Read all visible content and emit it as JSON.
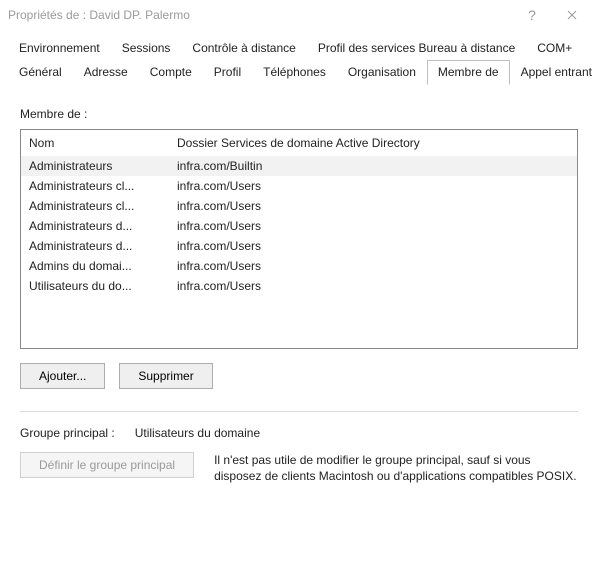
{
  "title": "Propriétés de : David DP. Palermo",
  "tabs_row1": [
    {
      "id": "environnement",
      "label": "Environnement"
    },
    {
      "id": "sessions",
      "label": "Sessions"
    },
    {
      "id": "controle",
      "label": "Contrôle à distance"
    },
    {
      "id": "profil-bureau",
      "label": "Profil des services Bureau à distance"
    },
    {
      "id": "complus",
      "label": "COM+"
    }
  ],
  "tabs_row2": [
    {
      "id": "general",
      "label": "Général"
    },
    {
      "id": "adresse",
      "label": "Adresse"
    },
    {
      "id": "compte",
      "label": "Compte"
    },
    {
      "id": "profil",
      "label": "Profil"
    },
    {
      "id": "telephones",
      "label": "Téléphones"
    },
    {
      "id": "organisation",
      "label": "Organisation"
    },
    {
      "id": "membre-de",
      "label": "Membre de"
    },
    {
      "id": "appel-entrant",
      "label": "Appel entrant"
    }
  ],
  "active_tab": "membre-de",
  "member_section": {
    "label": "Membre de :",
    "columns": {
      "name": "Nom",
      "folder": "Dossier Services de domaine Active Directory"
    },
    "rows": [
      {
        "name": "Administrateurs",
        "folder": "infra.com/Builtin",
        "selected": true
      },
      {
        "name": "Administrateurs cl...",
        "folder": "infra.com/Users"
      },
      {
        "name": "Administrateurs cl...",
        "folder": "infra.com/Users"
      },
      {
        "name": "Administrateurs d...",
        "folder": "infra.com/Users"
      },
      {
        "name": "Administrateurs d...",
        "folder": "infra.com/Users"
      },
      {
        "name": "Admins du domai...",
        "folder": "infra.com/Users"
      },
      {
        "name": "Utilisateurs du do...",
        "folder": "infra.com/Users"
      }
    ],
    "add_label": "Ajouter...",
    "remove_label": "Supprimer"
  },
  "primary_group": {
    "label": "Groupe principal :",
    "value": "Utilisateurs du domaine",
    "set_button": "Définir le groupe principal",
    "note": "Il n'est pas utile de modifier le groupe principal, sauf si vous disposez de clients Macintosh ou d'applications compatibles POSIX."
  }
}
